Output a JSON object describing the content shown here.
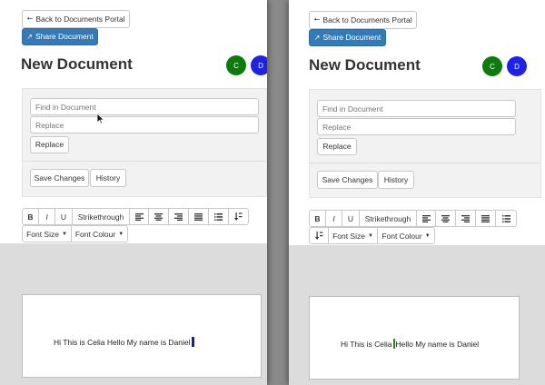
{
  "back_label": "Back to Documents Portal",
  "share_label": "Share Document",
  "title": "New Document",
  "avatars": [
    {
      "letter": "C",
      "color": "#0c7a0c"
    },
    {
      "letter": "D",
      "color": "#1e22e8"
    }
  ],
  "find_placeholder": "Find in Document",
  "replace_placeholder": "Replace",
  "replace_button": "Replace",
  "save_changes": "Save Changes",
  "history": "History",
  "toolbar": {
    "bold": "B",
    "italic": "I",
    "underline": "U",
    "strikethrough": "Strikethrough",
    "font_size": "Font Size",
    "font_colour": "Font Colour"
  },
  "left_doc": {
    "text": "Hi This is Celia Hello My name is Daniel"
  },
  "right_doc": {
    "before": "Hi This is Celia",
    "after": "Hello My name is Daniel"
  },
  "colors": {
    "primary": "#337ab7",
    "caret_blue": "#1a1aa8",
    "caret_green": "#1a8f1a"
  },
  "icons": [
    "arrow-left-icon",
    "share-icon",
    "align-left-icon",
    "align-center-icon",
    "align-right-icon",
    "align-justify-icon",
    "list-icon",
    "sort-icon",
    "caret-down-icon",
    "mouse-pointer-icon"
  ]
}
